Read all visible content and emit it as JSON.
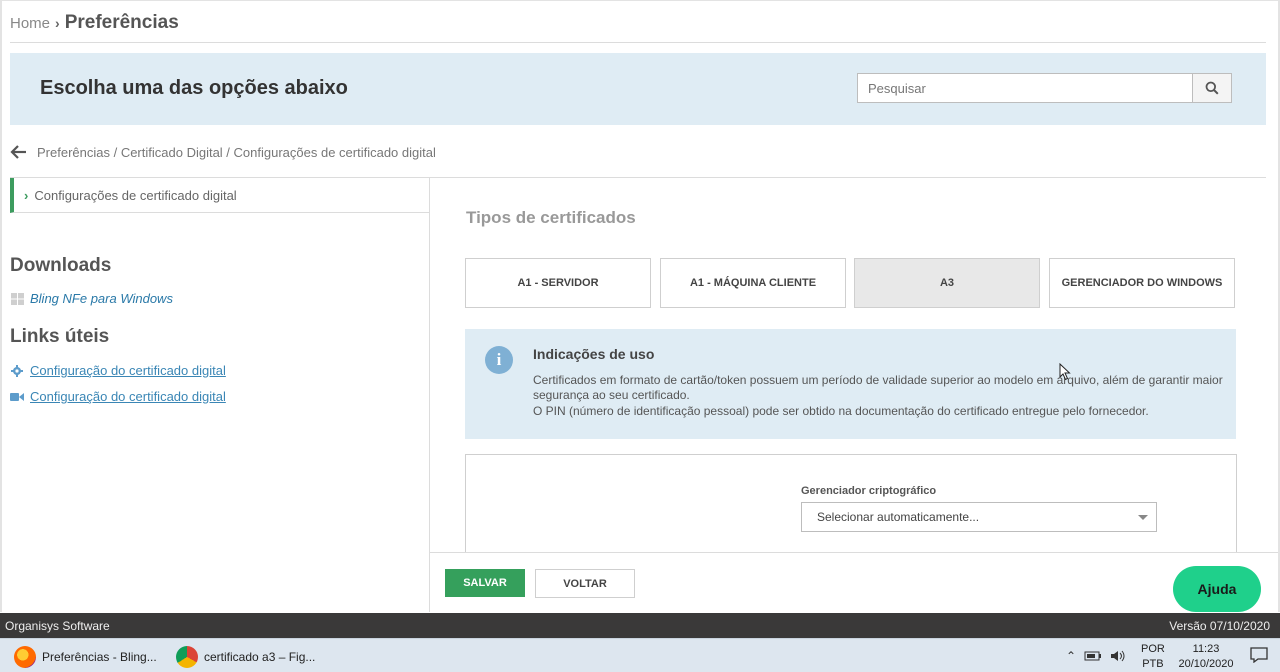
{
  "breadcrumb": {
    "home": "Home",
    "current": "Preferências"
  },
  "banner": {
    "title": "Escolha uma das opções abaixo",
    "search_placeholder": "Pesquisar"
  },
  "path": {
    "text": "Preferências / Certificado Digital / Configurações de certificado digital"
  },
  "sidebar": {
    "active_item": "Configurações de certificado digital",
    "downloads_title": "Downloads",
    "downloads": [
      {
        "label": "Bling NFe para Windows",
        "icon": "windows-icon"
      }
    ],
    "links_title": "Links úteis",
    "links": [
      {
        "label": "Configuração do certificado digital",
        "icon": "gear-icon"
      },
      {
        "label": "Configuração do certificado digital",
        "icon": "video-icon"
      }
    ]
  },
  "main": {
    "section_title": "Tipos de certificados",
    "tabs": [
      {
        "label": "A1 - SERVIDOR",
        "active": false
      },
      {
        "label": "A1 - MÁQUINA CLIENTE",
        "active": false
      },
      {
        "label": "A3",
        "active": true
      },
      {
        "label": "GERENCIADOR DO WINDOWS",
        "active": false
      }
    ],
    "info": {
      "title": "Indicações de uso",
      "text1": "Certificados em formato de cartão/token possuem um período de validade superior ao modelo em arquivo, além de garantir maior segurança ao seu certificado.",
      "text2": "O PIN (número de identificação pessoal) pode ser obtido na documentação do certificado entregue pelo fornecedor."
    },
    "form": {
      "label": "Gerenciador criptográfico",
      "select_value": "Selecionar automaticamente..."
    }
  },
  "actions": {
    "save": "SALVAR",
    "back": "VOLTAR",
    "help": "Ajuda"
  },
  "status": {
    "left": "Organisys Software",
    "right": "Versão 07/10/2020"
  },
  "taskbar": {
    "tasks": [
      {
        "label": "Preferências - Bling...",
        "icon": "firefox-icon"
      },
      {
        "label": "certificado a3 – Fig...",
        "icon": "chrome-icon"
      }
    ],
    "lang_top": "POR",
    "lang_bottom": "PTB",
    "time": "11:23",
    "date": "20/10/2020"
  },
  "colors": {
    "accent_green": "#35a05c",
    "help_green": "#1fd08b",
    "info_bg": "#dfecf4",
    "link_blue": "#3a86b5"
  }
}
